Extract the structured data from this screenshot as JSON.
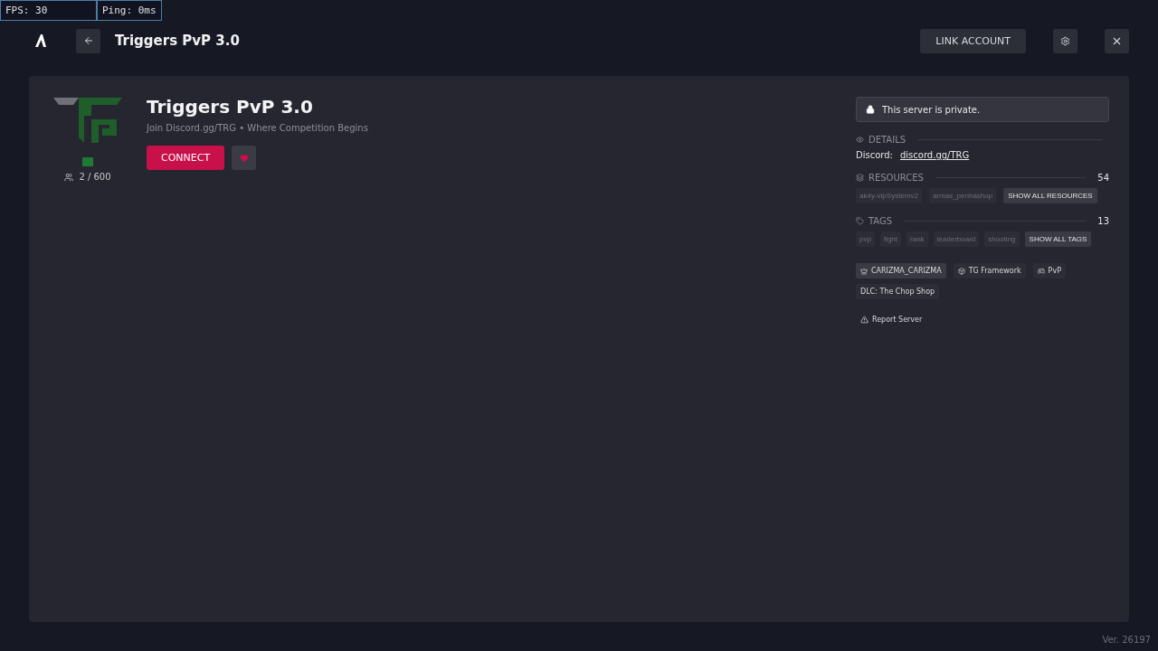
{
  "debug": {
    "fps": "FPS: 30",
    "ping": "Ping: 0ms"
  },
  "header": {
    "title": "Triggers PvP 3.0",
    "link_button": "LINK ACCOUNT"
  },
  "server": {
    "name": "Triggers PvP 3.0",
    "description": "Join Discord.gg/TRG • Where Competition Begins",
    "connect": "CONNECT",
    "favorite": true,
    "players": "2 / 600"
  },
  "private_notice": "This server is private.",
  "details": {
    "heading": "DETAILS",
    "label": "Discord:",
    "link": "discord.gg/TRG"
  },
  "resources": {
    "heading": "RESOURCES",
    "count": "54",
    "items": [
      "ak4y-vipSystemv2",
      "armas_penhashop"
    ],
    "show_all": "SHOW ALL RESOURCES"
  },
  "tags": {
    "heading": "TAGS",
    "count": "13",
    "items": [
      "pvp",
      "fight",
      "rank",
      "leaderboard",
      "shooting"
    ],
    "show_all": "SHOW ALL TAGS"
  },
  "badges": [
    {
      "kind": "owner",
      "label": "CARIZMA_CARIZMA"
    },
    {
      "kind": "framework",
      "label": "TG Framework"
    },
    {
      "kind": "gamemode",
      "label": "PvP"
    },
    {
      "kind": "plain",
      "label": "DLC: The Chop Shop"
    }
  ],
  "report": "Report Server",
  "version": "Ver. 26197"
}
